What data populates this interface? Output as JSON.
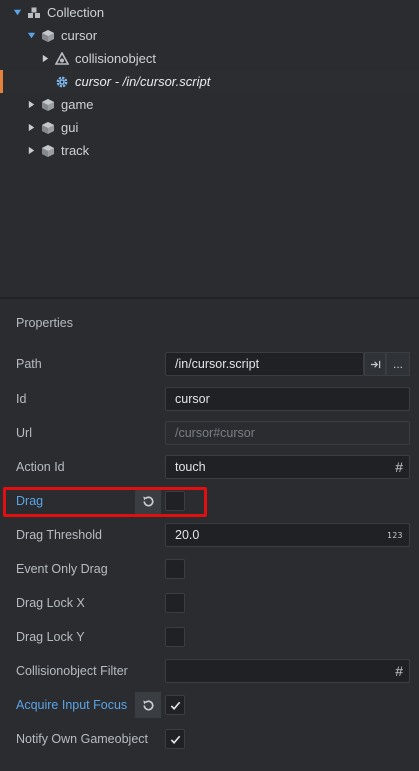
{
  "outline": {
    "items": [
      {
        "label": "Collection",
        "icon": "collection-icon",
        "expanded": true
      },
      {
        "label": "cursor",
        "icon": "game-object-icon",
        "expanded": true
      },
      {
        "label": "collisionobject",
        "icon": "collision-object-icon",
        "expanded": false
      },
      {
        "label": "cursor - /in/cursor.script",
        "icon": "script-gear-icon",
        "selected": true
      },
      {
        "label": "game",
        "icon": "game-object-icon",
        "expanded": false
      },
      {
        "label": "gui",
        "icon": "game-object-icon",
        "expanded": false
      },
      {
        "label": "track",
        "icon": "game-object-icon",
        "expanded": false
      }
    ]
  },
  "properties": {
    "title": "Properties",
    "path": {
      "label": "Path",
      "value": "/in/cursor.script",
      "goto_icon": "goto-file-icon",
      "browse_label": "..."
    },
    "id": {
      "label": "Id",
      "value": "cursor"
    },
    "url": {
      "label": "Url",
      "value": "/cursor#cursor"
    },
    "action_id": {
      "label": "Action Id",
      "value": "touch",
      "suffix": "#"
    },
    "drag": {
      "label": "Drag",
      "checked": false,
      "changed": true
    },
    "drag_threshold": {
      "label": "Drag Threshold",
      "value": "20.0",
      "suffix": "123"
    },
    "event_only_drag": {
      "label": "Event Only Drag",
      "checked": false
    },
    "drag_lock_x": {
      "label": "Drag Lock X",
      "checked": false
    },
    "drag_lock_y": {
      "label": "Drag Lock Y",
      "checked": false
    },
    "collision_filter": {
      "label": "Collisionobject Filter",
      "value": "",
      "suffix": "#"
    },
    "acquire_input_focus": {
      "label": "Acquire Input Focus",
      "checked": true,
      "changed": true
    },
    "notify_own_gameobject": {
      "label": "Notify Own Gameobject",
      "checked": true
    }
  },
  "colors": {
    "background": "#2a2c30",
    "changed_label": "#5aa4e6",
    "selection_marker": "#e4813a",
    "highlight_box": "#e01010"
  }
}
